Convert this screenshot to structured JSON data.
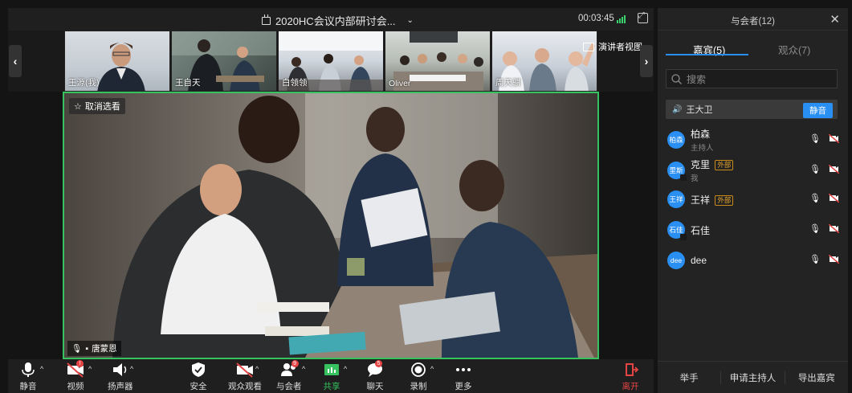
{
  "topbar": {
    "title": "2020HC会议内部研讨会...",
    "timer": "00:03:45"
  },
  "strip": {
    "speaker_view_label": "演讲者视图",
    "thumbnails": [
      {
        "name": "王源(我)"
      },
      {
        "name": "王自天"
      },
      {
        "name": "白领领"
      },
      {
        "name": "Oliver"
      },
      {
        "name": "周天骐"
      }
    ]
  },
  "main_video": {
    "unpin_label": "取消选看",
    "speaker_name": "唐蒙恩"
  },
  "toolbar": {
    "mute": "静音",
    "video": "视频",
    "speaker": "扬声器",
    "security": "安全",
    "audience_watch": "观众观看",
    "participants": "与会者",
    "share": "共享",
    "chat": "聊天",
    "record": "录制",
    "more": "更多",
    "leave": "离开",
    "participants_badge": "9",
    "chat_badge": "5"
  },
  "panel": {
    "title": "与会者(12)",
    "tab_guests": "嘉宾(5)",
    "tab_audience": "观众(7)",
    "search_placeholder": "搜索",
    "speaking_name": "王大卫",
    "mute_button": "静音",
    "participants": [
      {
        "avatar": "柏森",
        "name": "柏森",
        "role": "主持人",
        "tag": ""
      },
      {
        "avatar": "里斯",
        "name": "克里",
        "role": "我",
        "tag": "外部"
      },
      {
        "avatar": "王祥",
        "name": "王祥",
        "role": "",
        "tag": "外部"
      },
      {
        "avatar": "石佳",
        "name": "石佳",
        "role": "",
        "tag": ""
      },
      {
        "avatar": "dee",
        "name": "dee",
        "role": "",
        "tag": ""
      }
    ],
    "footer": {
      "raise_hand": "举手",
      "request_host": "申请主持人",
      "export_guests": "导出嘉宾"
    }
  },
  "colors": {
    "accent": "#2a8ff2",
    "active_border": "#35c25f",
    "leave": "#e64545",
    "external_tag": "#e3a22c"
  }
}
